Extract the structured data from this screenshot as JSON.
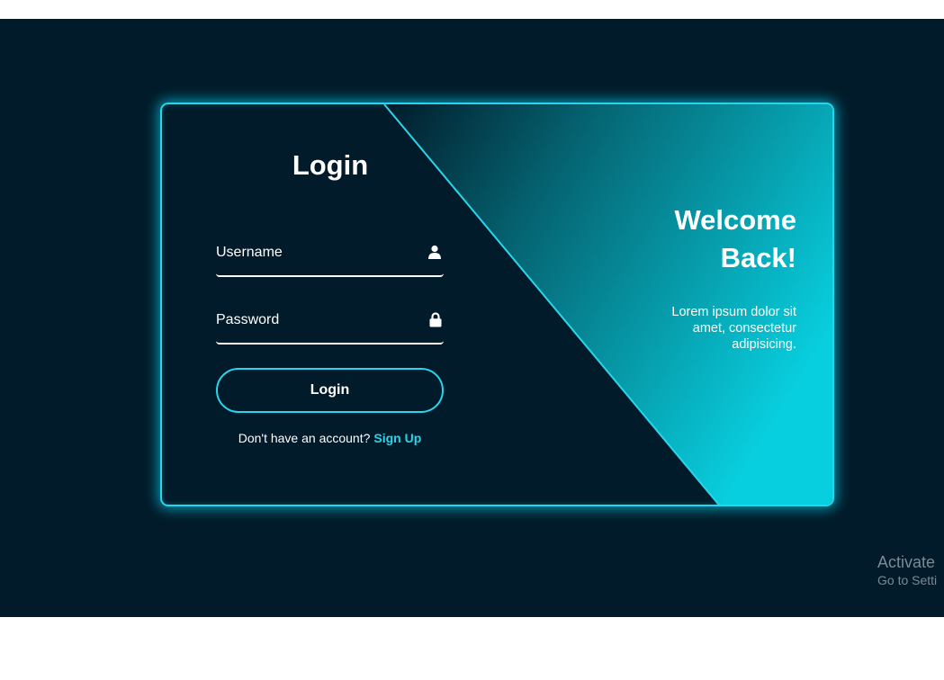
{
  "login": {
    "title": "Login",
    "username_label": "Username",
    "password_label": "Password",
    "button_label": "Login",
    "signup_prompt": "Don't have an account?",
    "signup_link": "Sign Up"
  },
  "welcome": {
    "title_line1": "Welcome",
    "title_line2": "Back!",
    "description_line1": "Lorem ipsum dolor sit",
    "description_line2": "amet, consectetur",
    "description_line3": "adipisicing."
  },
  "watermark": {
    "line1": "Activate",
    "line2": "Go to Setti"
  },
  "colors": {
    "background": "#021b2a",
    "accent": "#27d6ec",
    "text": "#ffffff",
    "watermark": "#7c8a94"
  },
  "icons": {
    "username": "user-icon",
    "password": "lock-icon"
  }
}
